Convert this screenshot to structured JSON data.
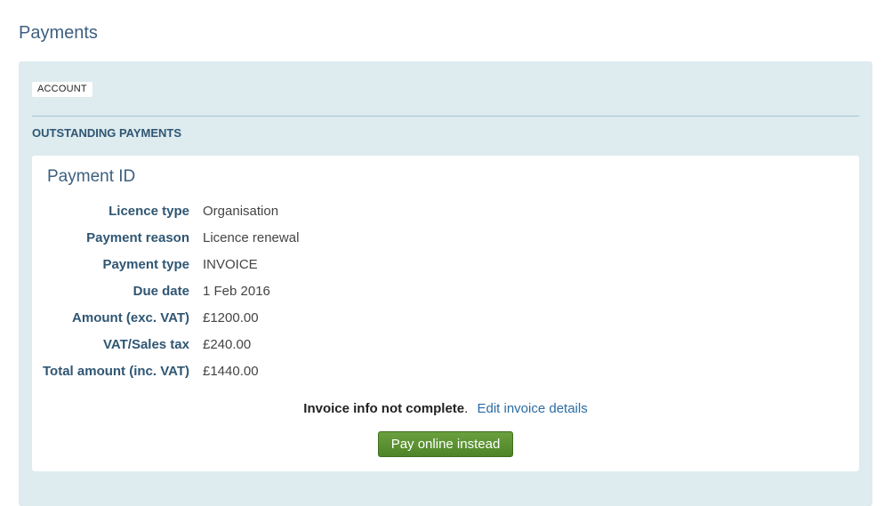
{
  "page": {
    "title": "Payments"
  },
  "panel": {
    "account_tag": "ACCOUNT",
    "section_title": "OUTSTANDING PAYMENTS"
  },
  "payment": {
    "title": "Payment ID",
    "rows": [
      {
        "label": "Licence type",
        "value": "Organisation"
      },
      {
        "label": "Payment reason",
        "value": "Licence renewal"
      },
      {
        "label": "Payment type",
        "value": "INVOICE"
      },
      {
        "label": "Due date",
        "value": "1 Feb 2016"
      },
      {
        "label": "Amount (exc. VAT)",
        "value": "£1200.00"
      },
      {
        "label": "VAT/Sales tax",
        "value": "£240.00"
      },
      {
        "label": "Total amount (inc. VAT)",
        "value": "£1440.00"
      }
    ],
    "invoice_warning": "Invoice info not complete",
    "invoice_warning_suffix": ".",
    "edit_link": "Edit invoice details",
    "pay_button": "Pay online instead"
  },
  "colors": {
    "panel_bg": "#deebef",
    "heading": "#3d6080",
    "label": "#2f5673",
    "link": "#2b6ca3",
    "button": "#5a9132"
  }
}
